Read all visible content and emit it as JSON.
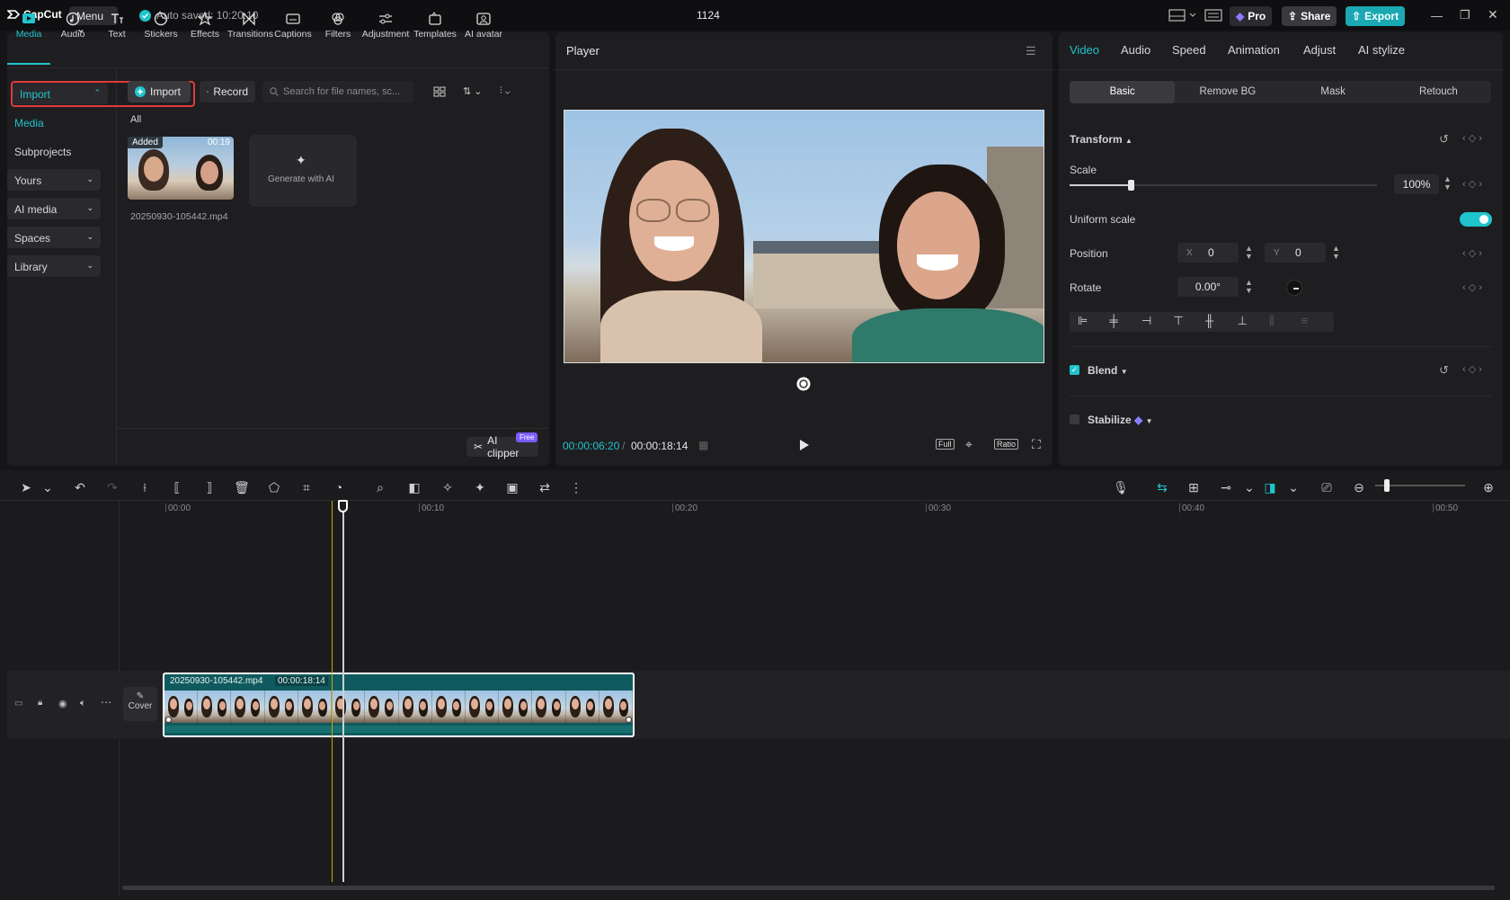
{
  "app": {
    "logo": "CapCut",
    "menu": "Menu",
    "autosave": "Auto saved: 10:20:10",
    "project_title": "1124",
    "pro": "Pro",
    "share": "Share",
    "export": "Export"
  },
  "media_toolbar": [
    {
      "label": "Media",
      "icon": "media-icon"
    },
    {
      "label": "Audio",
      "icon": "audio-icon"
    },
    {
      "label": "Text",
      "icon": "text-icon"
    },
    {
      "label": "Stickers",
      "icon": "stickers-icon"
    },
    {
      "label": "Effects",
      "icon": "effects-icon"
    },
    {
      "label": "Transitions",
      "icon": "transitions-icon"
    },
    {
      "label": "Captions",
      "icon": "captions-icon"
    },
    {
      "label": "Filters",
      "icon": "filters-icon"
    },
    {
      "label": "Adjustment",
      "icon": "adjustment-icon"
    },
    {
      "label": "Templates",
      "icon": "templates-icon"
    },
    {
      "label": "AI avatar",
      "icon": "ai-avatar-icon"
    }
  ],
  "sidebar": {
    "import": "Import",
    "media": "Media",
    "subprojects": "Subprojects",
    "yours": "Yours",
    "ai_media": "AI media",
    "spaces": "Spaces",
    "library": "Library"
  },
  "media_panel": {
    "import_btn": "Import",
    "record_btn": "Record",
    "search_placeholder": "Search for file names, sc...",
    "filter_all": "All",
    "clip": {
      "badge": "Added",
      "duration": "00:19",
      "name": "20250930-105442.mp4"
    },
    "generate_ai": "Generate with AI",
    "ai_clipper": "AI clipper",
    "free_badge": "Free"
  },
  "player": {
    "title": "Player",
    "current_time": "00:00:06:20",
    "total_time": "00:00:18:14",
    "full": "Full",
    "ratio": "Ratio"
  },
  "inspector": {
    "tabs": [
      "Video",
      "Audio",
      "Speed",
      "Animation",
      "Adjust",
      "AI stylize"
    ],
    "subtabs": [
      "Basic",
      "Remove BG",
      "Mask",
      "Retouch"
    ],
    "transform": "Transform",
    "scale_label": "Scale",
    "scale_value": "100%",
    "scale_fraction": 0.2,
    "uniform_scale": "Uniform scale",
    "position_label": "Position",
    "pos_x_label": "X",
    "pos_x": "0",
    "pos_y_label": "Y",
    "pos_y": "0",
    "rotate_label": "Rotate",
    "rotate_value": "0.00°",
    "blend": "Blend",
    "stabilize": "Stabilize"
  },
  "timeline": {
    "ruler": [
      "00:00",
      "00:10",
      "00:20",
      "00:30",
      "00:40",
      "00:50"
    ],
    "clip_name": "20250930-105442.mp4",
    "clip_duration": "00:00:18:14",
    "cover": "Cover"
  },
  "colors": {
    "accent": "#20c4cc",
    "export": "#1aa9b3",
    "clip_bg": "#0f5a5e",
    "highlight_box": "#e03a3a"
  }
}
